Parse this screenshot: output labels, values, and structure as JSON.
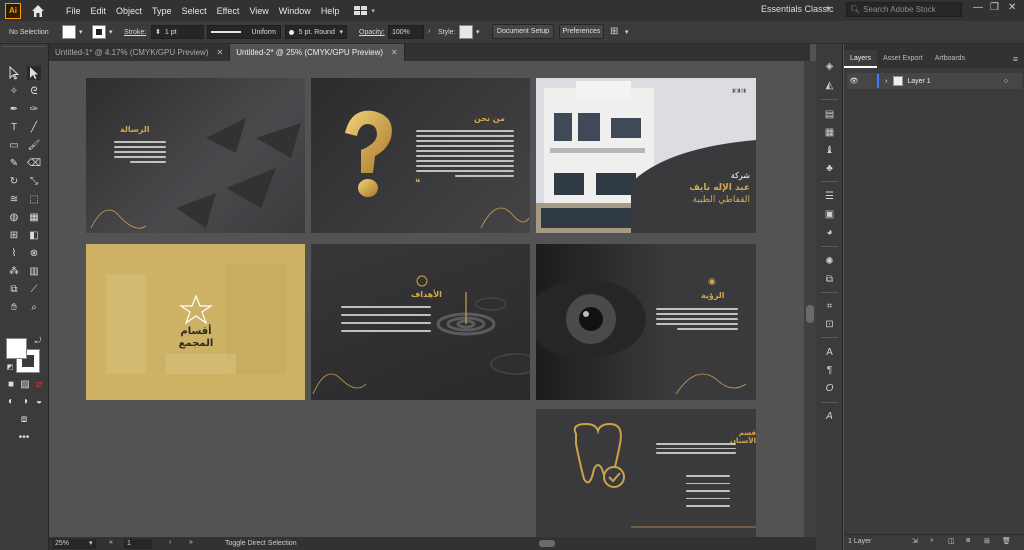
{
  "app": {
    "logo": "Ai",
    "workspace": "Essentials Classic",
    "stock_search_placeholder": "Search Adobe Stock"
  },
  "menu": [
    "File",
    "Edit",
    "Object",
    "Type",
    "Select",
    "Effect",
    "View",
    "Window",
    "Help"
  ],
  "control": {
    "selection": "No Selection",
    "stroke_label": "Stroke:",
    "stroke_weight": "1 pt",
    "profile": "Uniform",
    "brush": "5 pt. Round",
    "opacity_label": "Opacity:",
    "opacity": "100%",
    "style_label": "Style:",
    "document_setup": "Document Setup",
    "preferences": "Preferences"
  },
  "tabs": [
    {
      "label": "Untitled-1* @ 4.17% (CMYK/GPU Preview)",
      "active": false
    },
    {
      "label": "Untitled-2* @ 25% (CMYK/GPU Preview)",
      "active": true
    }
  ],
  "status": {
    "zoom": "25%",
    "artboard": "1",
    "tool": "Toggle Direct Selection"
  },
  "layers_panel": {
    "tabs": [
      "Layers",
      "Asset Export",
      "Artboards"
    ],
    "layer_name": "Layer 1",
    "footer": "1 Layer"
  },
  "artboards": {
    "mission_title": "الرسالة",
    "about_title": "من نحن",
    "company_line1": "شركة",
    "company_line2": "عبد الإله نايف",
    "company_line3": "القفاطي الطبية",
    "departments": "أقسام المجمع",
    "goals_title": "الأهداف",
    "vision_title": "الرؤية",
    "dental_title": "قسم الأسنان",
    "colors": {
      "gold": "#d4a84c",
      "dark": "#3a3a3d"
    }
  }
}
